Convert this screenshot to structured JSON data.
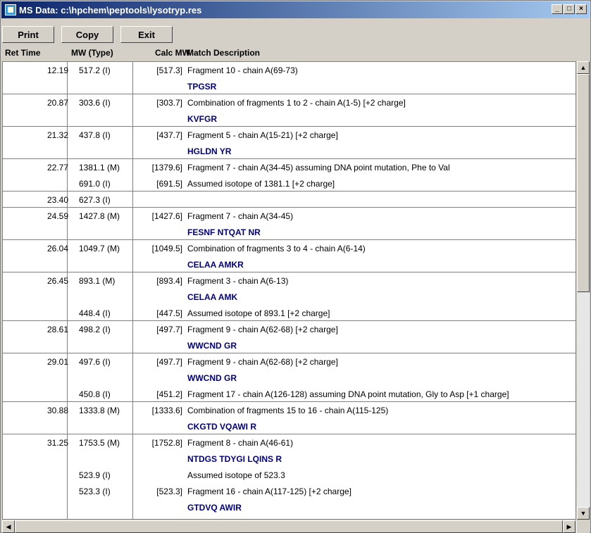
{
  "window": {
    "title": "MS Data: c:\\hpchem\\peptools\\lysotryp.res",
    "minimize": "_",
    "maximize": "□",
    "close": "×"
  },
  "toolbar": {
    "print": "Print",
    "copy": "Copy",
    "exit": "Exit"
  },
  "headers": {
    "ret_time": "Ret Time",
    "mw_type": "MW (Type)",
    "calc_mw": "Calc MW",
    "match": "Match Description"
  },
  "rows": [
    {
      "rt": "12.19",
      "mw": "517.2  (I)",
      "calc": "[517.3]",
      "desc": "Fragment 10 - chain A(69-73)"
    },
    {
      "rt": "",
      "mw": "",
      "calc": "",
      "seq": "TPGSR",
      "sep": true
    },
    {
      "rt": "20.87",
      "mw": "303.6  (I)",
      "calc": "[303.7]",
      "desc": "Combination of fragments 1 to 2 - chain A(1-5) [+2 charge]"
    },
    {
      "rt": "",
      "mw": "",
      "calc": "",
      "seq": "KVFGR",
      "sep": true
    },
    {
      "rt": "21.32",
      "mw": "437.8  (I)",
      "calc": "[437.7]",
      "desc": "Fragment 5 - chain A(15-21) [+2 charge]"
    },
    {
      "rt": "",
      "mw": "",
      "calc": "",
      "seq": "HGLDN YR",
      "sep": true
    },
    {
      "rt": "22.77",
      "mw": "1381.1  (M)",
      "calc": "[1379.6]",
      "desc": "Fragment 7 - chain A(34-45) assuming DNA point mutation, Phe to Val"
    },
    {
      "rt": "",
      "mw": "691.0  (I)",
      "calc": "[691.5]",
      "desc": "Assumed isotope of 1381.1 [+2 charge]",
      "sep": true
    },
    {
      "rt": "23.40",
      "mw": "627.3  (I)",
      "calc": "",
      "desc": "",
      "sep": true
    },
    {
      "rt": "24.59",
      "mw": "1427.8  (M)",
      "calc": "[1427.6]",
      "desc": "Fragment 7 - chain A(34-45)"
    },
    {
      "rt": "",
      "mw": "",
      "calc": "",
      "seq": "FESNF NTQAT NR",
      "sep": true
    },
    {
      "rt": "26.04",
      "mw": "1049.7  (M)",
      "calc": "[1049.5]",
      "desc": "Combination of fragments 3 to 4 - chain A(6-14)"
    },
    {
      "rt": "",
      "mw": "",
      "calc": "",
      "seq": "CELAA AMKR",
      "sep": true
    },
    {
      "rt": "26.45",
      "mw": "893.1  (M)",
      "calc": "[893.4]",
      "desc": "Fragment 3 - chain A(6-13)"
    },
    {
      "rt": "",
      "mw": "",
      "calc": "",
      "seq": "CELAA AMK"
    },
    {
      "rt": "",
      "mw": "448.4  (I)",
      "calc": "[447.5]",
      "desc": "Assumed isotope of 893.1 [+2 charge]",
      "sep": true
    },
    {
      "rt": "28.61",
      "mw": "498.2  (I)",
      "calc": "[497.7]",
      "desc": "Fragment 9 - chain A(62-68) [+2 charge]"
    },
    {
      "rt": "",
      "mw": "",
      "calc": "",
      "seq": "WWCND GR",
      "sep": true
    },
    {
      "rt": "29.01",
      "mw": "497.6  (I)",
      "calc": "[497.7]",
      "desc": "Fragment 9 - chain A(62-68) [+2 charge]"
    },
    {
      "rt": "",
      "mw": "",
      "calc": "",
      "seq": "WWCND GR"
    },
    {
      "rt": "",
      "mw": "450.8  (I)",
      "calc": "[451.2]",
      "desc": "Fragment 17 - chain A(126-128) assuming DNA point mutation, Gly to Asp [+1 charge]",
      "sep": true
    },
    {
      "rt": "30.88",
      "mw": "1333.8  (M)",
      "calc": "[1333.6]",
      "desc": "Combination of fragments 15 to 16 - chain A(115-125)"
    },
    {
      "rt": "",
      "mw": "",
      "calc": "",
      "seq": "CKGTD VQAWI R",
      "sep": true
    },
    {
      "rt": "31.25",
      "mw": "1753.5  (M)",
      "calc": "[1752.8]",
      "desc": "Fragment 8 - chain A(46-61)"
    },
    {
      "rt": "",
      "mw": "",
      "calc": "",
      "seq": "NTDGS TDYGI LQINS R"
    },
    {
      "rt": "",
      "mw": "523.9  (I)",
      "calc": "",
      "desc": "Assumed isotope of 523.3"
    },
    {
      "rt": "",
      "mw": "523.3  (I)",
      "calc": "[523.3]",
      "desc": "Fragment 16 - chain A(117-125) [+2 charge]"
    },
    {
      "rt": "",
      "mw": "",
      "calc": "",
      "seq": "GTDVQ AWIR"
    }
  ]
}
